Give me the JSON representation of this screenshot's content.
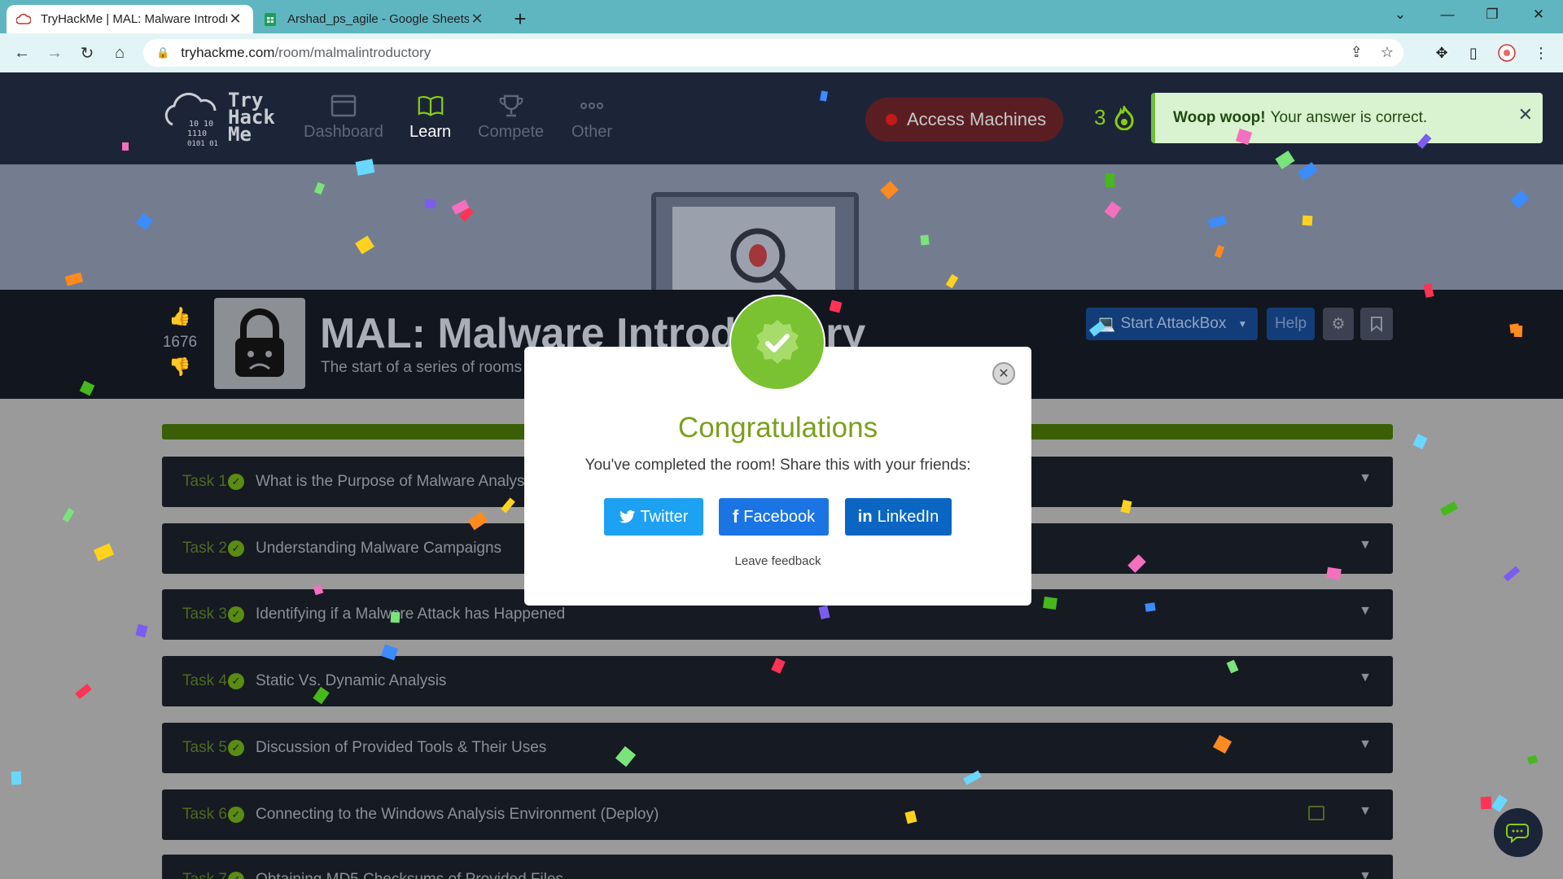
{
  "browser": {
    "tabs": [
      {
        "title": "TryHackMe | MAL: Malware Introductory",
        "active": true
      },
      {
        "title": "Arshad_ps_agile - Google Sheets",
        "active": false
      }
    ],
    "url_host": "tryhackme.com",
    "url_path": "/room/malmalintroductory"
  },
  "nav": {
    "logo": "Try Hack Me",
    "items": [
      {
        "label": "Dashboard",
        "icon": "dashboard-icon",
        "active": false
      },
      {
        "label": "Learn",
        "icon": "book-icon",
        "active": true
      },
      {
        "label": "Compete",
        "icon": "trophy-icon",
        "active": false
      },
      {
        "label": "Other",
        "icon": "more-icon",
        "active": false
      }
    ],
    "access_machines": "Access Machines",
    "streak": "3"
  },
  "toast": {
    "strong": "Woop woop!",
    "text": "Your answer is correct."
  },
  "room": {
    "upvotes": "1676",
    "title": "MAL: Malware Introductory",
    "subtitle": "The start of a series of rooms covering Malware Analysis",
    "start_attackbox": "Start AttackBox",
    "help": "Help"
  },
  "tasks": [
    {
      "num": "Task 1",
      "title": "What is the Purpose of Malware Analysis?"
    },
    {
      "num": "Task 2",
      "title": "Understanding Malware Campaigns"
    },
    {
      "num": "Task 3",
      "title": "Identifying if a Malware Attack has Happened"
    },
    {
      "num": "Task 4",
      "title": "Static Vs. Dynamic Analysis"
    },
    {
      "num": "Task 5",
      "title": "Discussion of Provided Tools & Their Uses"
    },
    {
      "num": "Task 6",
      "title": "Connecting to the Windows Analysis Environment (Deploy)"
    },
    {
      "num": "Task 7",
      "title": "Obtaining MD5 Checksums of Provided Files"
    }
  ],
  "modal": {
    "title": "Congratulations",
    "message": "You've completed the room! Share this with your friends:",
    "twitter": "Twitter",
    "facebook": "Facebook",
    "linkedin": "LinkedIn",
    "feedback": "Leave feedback"
  },
  "colors": {
    "thm_green": "#88cc14",
    "nav_bg": "#1c2538",
    "chrome_tab": "#5fb6c1",
    "toast_bg": "#d9f2cf"
  }
}
